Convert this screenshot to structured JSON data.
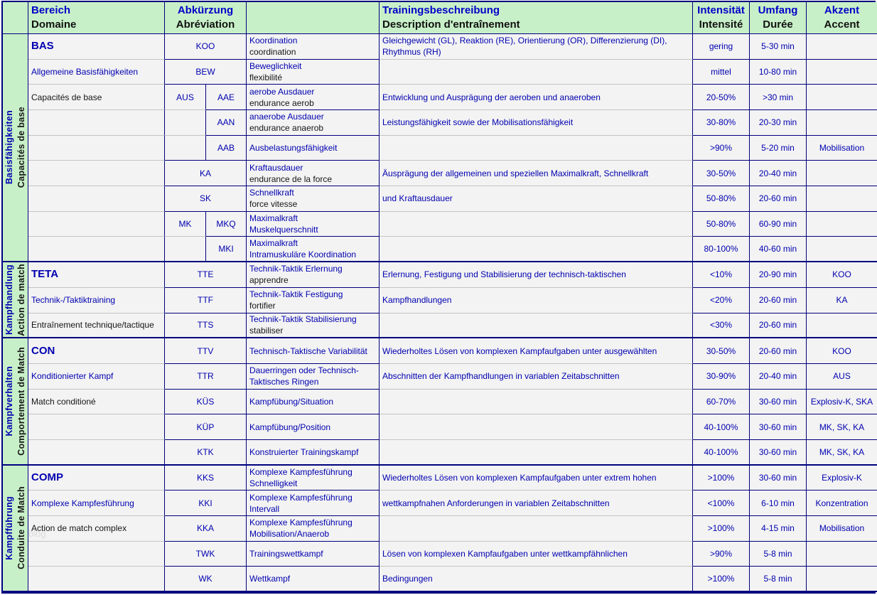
{
  "watermark": "blog",
  "colors": {
    "header_green": "#c8f0c8",
    "grid_navy": "#00007e",
    "grid_gray": "#c4c4c4",
    "text_blue": "#0000b0",
    "text_black": "#151515",
    "cell_bg": "#f3f3f3"
  },
  "header": {
    "domain": {
      "de": "Bereich",
      "fr": "Domaine"
    },
    "abbr": {
      "de": "Abkürzung",
      "fr": "Abréviation"
    },
    "name": {
      "de": "",
      "fr": ""
    },
    "desc": {
      "de": "Trainingsbeschreibung",
      "fr": "Description d'entraînement"
    },
    "intensity": {
      "de": "Intensität",
      "fr": "Intensité"
    },
    "volume": {
      "de": "Umfang",
      "fr": "Durée"
    },
    "accent": {
      "de": "Akzent",
      "fr": "Accent"
    }
  },
  "sections": [
    {
      "side": {
        "de": "Basisfähigkeiten",
        "fr": "Capacités de base"
      },
      "domain": {
        "title": "BAS",
        "de": "Allgemeine Basisfähigkeiten",
        "fr": "Capacités de base"
      },
      "rows": [
        {
          "split": false,
          "abbr": "KOO",
          "name": [
            "Koordination",
            "coordination"
          ],
          "name2_black": true,
          "desc": [
            "Gleichgewicht (GL), Reaktion (RE), Orientierung (OR), Differenzierung (DI),",
            "Rhythmus (RH)"
          ],
          "intensity": "gering",
          "volume": "5-30 min",
          "accent": ""
        },
        {
          "split": false,
          "abbr": "BEW",
          "name": [
            "Beweglichkeit",
            "flexibilité"
          ],
          "name2_black": true,
          "desc": [],
          "intensity": "mittel",
          "volume": "10-80 min",
          "accent": ""
        },
        {
          "split": true,
          "abbr_left": "AUS",
          "abbr_right": "AAE",
          "name": [
            "aerobe Ausdauer",
            "endurance aerob"
          ],
          "name2_black": true,
          "desc": [
            "Entwicklung und Ausprägung der aeroben und anaeroben"
          ],
          "intensity": "20-50%",
          "volume": ">30 min",
          "accent": ""
        },
        {
          "split": true,
          "abbr_left": "",
          "abbr_right": "AAN",
          "name": [
            "anaerobe Ausdauer",
            "endurance anaerob"
          ],
          "name2_black": true,
          "desc": [
            "Leistungsfähigkeit sowie der Mobilisationsfähigkeit"
          ],
          "intensity": "30-80%",
          "volume": "20-30 min",
          "accent": ""
        },
        {
          "split": true,
          "abbr_left": "",
          "abbr_right": "AAB",
          "name": [
            "Ausbelastungsfähigkeit",
            ""
          ],
          "name2_black": false,
          "desc": [],
          "intensity": ">90%",
          "volume": "5-20 min",
          "accent": "Mobilisation"
        },
        {
          "split": false,
          "abbr": "KA",
          "name": [
            "Kraftausdauer",
            "endurance de la force"
          ],
          "name2_black": true,
          "desc": [
            "Äusprägung der allgemeinen und speziellen Maximalkraft, Schnellkraft"
          ],
          "intensity": "30-50%",
          "volume": "20-40 min",
          "accent": ""
        },
        {
          "split": false,
          "abbr": "SK",
          "name": [
            "Schnellkraft",
            "force vitesse"
          ],
          "name2_black": true,
          "desc": [
            "und Kraftausdauer"
          ],
          "intensity": "50-80%",
          "volume": "20-60 min",
          "accent": ""
        },
        {
          "split": true,
          "abbr_left": "MK",
          "abbr_right": "MKQ",
          "name": [
            "Maximalkraft",
            "Muskelquerschnitt"
          ],
          "name2_black": false,
          "desc": [],
          "intensity": "50-80%",
          "volume": "60-90 min",
          "accent": ""
        },
        {
          "split": true,
          "abbr_left": "",
          "abbr_right": "MKI",
          "name": [
            "Maximalkraft",
            "Intramuskuläre Koordination"
          ],
          "name2_black": false,
          "desc": [],
          "intensity": "80-100%",
          "volume": "40-60 min",
          "accent": ""
        }
      ]
    },
    {
      "side": {
        "de": "Kampfhandlung",
        "fr": "Action de match"
      },
      "domain": {
        "title": "TETA",
        "de": "Technik-/Taktiktraining",
        "fr": "Entraînement technique/tactique"
      },
      "rows": [
        {
          "split": false,
          "abbr": "TTE",
          "name": [
            "Technik-Taktik Erlernung",
            "apprendre"
          ],
          "name2_black": true,
          "desc": [
            "Erlernung, Festigung und Stabilisierung der technisch-taktischen"
          ],
          "intensity": "<10%",
          "volume": "20-90 min",
          "accent": "KOO"
        },
        {
          "split": false,
          "abbr": "TTF",
          "name": [
            "Technik-Taktik Festigung",
            "fortifier"
          ],
          "name2_black": true,
          "desc": [
            "Kampfhandlungen"
          ],
          "intensity": "<20%",
          "volume": "20-60 min",
          "accent": "KA"
        },
        {
          "split": false,
          "abbr": "TTS",
          "name": [
            "Technik-Taktik Stabilisierung",
            "stabiliser"
          ],
          "name2_black": true,
          "desc": [],
          "intensity": "<30%",
          "volume": "20-60 min",
          "accent": ""
        }
      ]
    },
    {
      "side": {
        "de": "Kampfverhalten",
        "fr": "Comportement de Match"
      },
      "domain": {
        "title": "CON",
        "de": "Konditionierter Kampf",
        "fr": "Match conditioné"
      },
      "rows": [
        {
          "split": false,
          "abbr": "TTV",
          "name": [
            "Technisch-Taktische Variabilität",
            ""
          ],
          "name2_black": false,
          "desc": [
            "Wiederholtes Lösen von komplexen Kampfaufgaben unter ausgewählten"
          ],
          "intensity": "30-50%",
          "volume": "20-60 min",
          "accent": "KOO"
        },
        {
          "split": false,
          "abbr": "TTR",
          "name": [
            "Dauerringen oder Technisch-",
            "Taktisches Ringen"
          ],
          "name2_black": false,
          "desc": [
            "Abschnitten der Kampfhandlungen in variablen Zeitabschnitten"
          ],
          "intensity": "30-90%",
          "volume": "20-40 min",
          "accent": "AUS"
        },
        {
          "split": false,
          "abbr": "KÜS",
          "name": [
            "Kampfübung/Situation",
            ""
          ],
          "name2_black": false,
          "desc": [],
          "intensity": "60-70%",
          "volume": "30-60 min",
          "accent": "Explosiv-K, SKA"
        },
        {
          "split": false,
          "abbr": "KÜP",
          "name": [
            "Kampfübung/Position",
            ""
          ],
          "name2_black": false,
          "desc": [],
          "intensity": "40-100%",
          "volume": "30-60 min",
          "accent": "MK, SK, KA"
        },
        {
          "split": false,
          "abbr": "KTK",
          "name": [
            "Konstruierter Trainingskampf",
            ""
          ],
          "name2_black": false,
          "desc": [],
          "intensity": "40-100%",
          "volume": "30-60 min",
          "accent": "MK, SK, KA"
        }
      ]
    },
    {
      "side": {
        "de": "Kampfführung",
        "fr": "Conduite de Match"
      },
      "domain": {
        "title": "COMP",
        "de": "Komplexe Kampfesführung",
        "fr": "Action de match complex"
      },
      "rows": [
        {
          "split": false,
          "abbr": "KKS",
          "name": [
            "Komplexe Kampfesführung",
            "Schnelligkeit"
          ],
          "name2_black": false,
          "desc": [
            "Wiederholtes Lösen von komplexen Kampfaufgaben unter extrem hohen"
          ],
          "intensity": ">100%",
          "volume": "30-60 min",
          "accent": "Explosiv-K"
        },
        {
          "split": false,
          "abbr": "KKI",
          "name": [
            "Komplexe Kampfesführung",
            "Intervall"
          ],
          "name2_black": false,
          "desc": [
            "wettkampfnahen Anforderungen in variablen Zeitabschnitten"
          ],
          "intensity": "<100%",
          "volume": "6-10 min",
          "accent": "Konzentration"
        },
        {
          "split": false,
          "abbr": "KKA",
          "name": [
            "Komplexe Kampfesführung",
            "Mobilisation/Anaerob"
          ],
          "name2_black": false,
          "desc": [],
          "intensity": ">100%",
          "volume": "4-15 min",
          "accent": "Mobilisation"
        },
        {
          "split": false,
          "abbr": "TWK",
          "name": [
            "Trainingswettkampf",
            ""
          ],
          "name2_black": false,
          "desc": [
            "Lösen von komplexen Kampfaufgaben unter wettkampfähnlichen"
          ],
          "intensity": ">90%",
          "volume": "5-8 min",
          "accent": ""
        },
        {
          "split": false,
          "abbr": "WK",
          "name": [
            "Wettkampf",
            ""
          ],
          "name2_black": false,
          "desc": [
            "Bedingungen"
          ],
          "intensity": ">100%",
          "volume": "5-8 min",
          "accent": ""
        }
      ]
    }
  ]
}
